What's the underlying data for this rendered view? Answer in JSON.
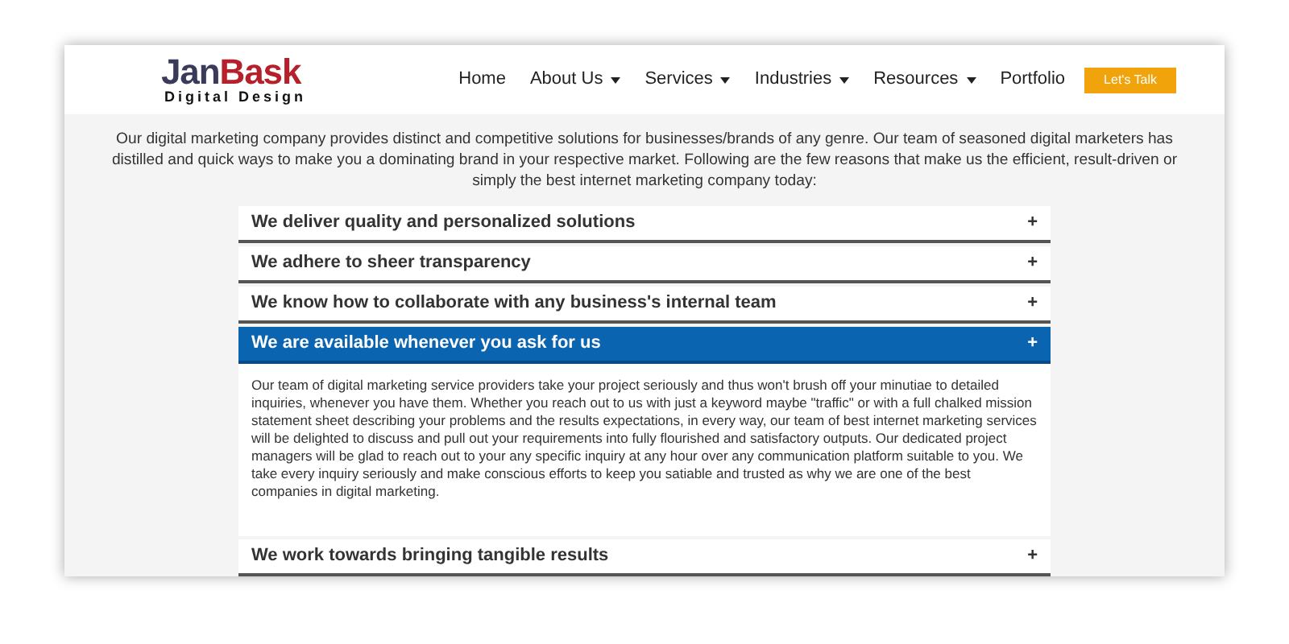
{
  "logo": {
    "brand_first": "Jan",
    "brand_second": "Bask",
    "tagline": "Digital Design"
  },
  "nav": [
    {
      "label": "Home",
      "has_dropdown": false
    },
    {
      "label": "About Us",
      "has_dropdown": true
    },
    {
      "label": "Services",
      "has_dropdown": true
    },
    {
      "label": "Industries",
      "has_dropdown": true
    },
    {
      "label": "Resources",
      "has_dropdown": true
    },
    {
      "label": "Portfolio",
      "has_dropdown": false
    }
  ],
  "cta_button": "Let's Talk",
  "intro": "Our digital marketing company provides distinct and competitive solutions for businesses/brands of any genre. Our team of seasoned digital marketers has distilled and quick ways to make you a dominating brand in your respective market. Following are the few reasons that make us the efficient, result-driven or simply the best internet marketing company today:",
  "accordion": [
    {
      "title": "We deliver quality and personalized solutions",
      "toggle": "+",
      "expanded": false
    },
    {
      "title": "We adhere to sheer transparency",
      "toggle": "+",
      "expanded": false
    },
    {
      "title": "We know how to collaborate with any business's internal team",
      "toggle": "+",
      "expanded": false
    },
    {
      "title": "We are available whenever you ask for us",
      "toggle": "+",
      "expanded": true,
      "body": "Our team of digital marketing service providers take your project seriously and thus won't brush off your minutiae to detailed inquiries, whenever you have them. Whether you reach out to us with just a keyword maybe \"traffic\" or with a full chalked mission statement sheet describing your problems and the results expectations, in every way, our team of best internet marketing services will be delighted to discuss and pull out your requirements into fully flourished and satisfactory outputs. Our dedicated project managers will be glad to reach out to your any specific inquiry at any hour over any communication platform suitable to you. We take every inquiry seriously and make conscious efforts to keep you satiable and trusted as why we are one of the best companies in digital marketing."
    },
    {
      "title": "We work towards bringing tangible results",
      "toggle": "+",
      "expanded": false
    }
  ]
}
